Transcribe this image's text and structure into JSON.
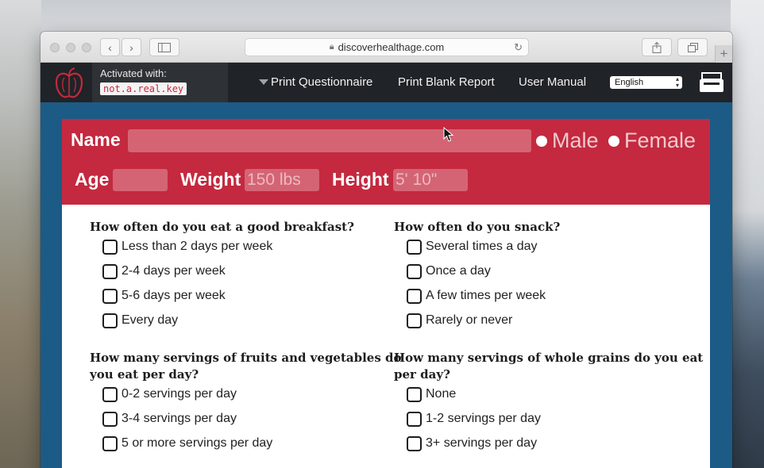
{
  "browser": {
    "url": "discoverhealthage.com"
  },
  "navbar": {
    "activated_label": "Activated with:",
    "activation_key": "not.a.real.key",
    "links": [
      "Print Questionnaire",
      "Print Blank Report",
      "User Manual"
    ],
    "language": "English"
  },
  "form": {
    "name_label": "Name",
    "name_value": "",
    "gender_options": [
      "Male",
      "Female"
    ],
    "age_label": "Age",
    "age_value": "",
    "weight_label": "Weight",
    "weight_placeholder": "150 lbs",
    "height_label": "Height",
    "height_placeholder": "5' 10\""
  },
  "questions": [
    {
      "text": "How often do you eat a good breakfast?",
      "options": [
        "Less than 2 days per week",
        "2-4 days per week",
        "5-6 days per week",
        "Every day"
      ]
    },
    {
      "text": "How often do you snack?",
      "options": [
        "Several times a day",
        "Once a day",
        "A few times per week",
        "Rarely or never"
      ]
    },
    {
      "text_line1": "How many servings of fruits and vegetables do",
      "text_line2": "you eat per day?",
      "options": [
        "0-2 servings per day",
        "3-4 servings per day",
        "5 or more servings per day"
      ]
    },
    {
      "text_line1": "How many servings of whole grains do you eat",
      "text_line2": "per day?",
      "options": [
        "None",
        "1-2 servings per day",
        "3+ servings per day"
      ]
    }
  ],
  "colors": {
    "brand_red": "#c4293f",
    "navbar": "#202327",
    "page_background": "#1c5b86"
  },
  "icons": [
    "back-arrow-icon",
    "forward-arrow-icon",
    "sidebar-icon",
    "lock-icon",
    "reload-icon",
    "share-icon",
    "tabs-icon",
    "plus-icon",
    "apple-logo-icon",
    "chevron-down-icon",
    "printer-icon",
    "pointer-cursor-icon"
  ]
}
